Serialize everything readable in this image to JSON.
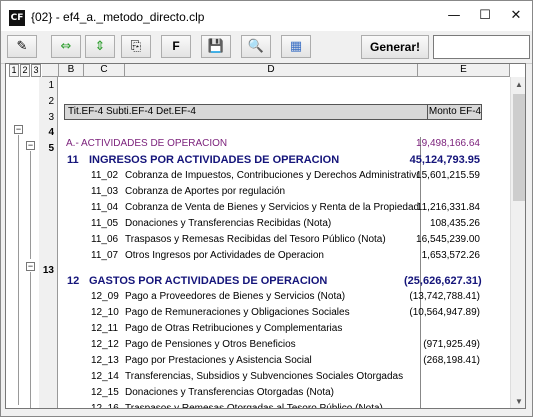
{
  "window": {
    "app_icon": "CF",
    "title": "{02} - ef4_a._metodo_directo.clp",
    "min_glyph": "—",
    "max_glyph": "☐",
    "close_glyph": "✕"
  },
  "toolbar": {
    "buttons": [
      {
        "name": "pencil-icon",
        "glyph": "✎"
      },
      {
        "name": "horizontal-arrows-icon",
        "glyph": "⇔"
      },
      {
        "name": "vertical-arrows-icon",
        "glyph": "⇕"
      },
      {
        "name": "copy-icon",
        "glyph": "⎘"
      },
      {
        "name": "f-button",
        "glyph": "F"
      },
      {
        "name": "save-icon",
        "glyph": "💾"
      },
      {
        "name": "preview-icon",
        "glyph": "🔍"
      },
      {
        "name": "grid-icon",
        "glyph": "▦"
      }
    ],
    "generate_label": "Generar!",
    "input_value": ""
  },
  "sheet": {
    "outline_levels": [
      "1",
      "2",
      "3"
    ],
    "columns": [
      "B",
      "C",
      "D",
      "E"
    ],
    "header": {
      "left": "Tit.EF-4  Subti.EF-4  Det.EF-4",
      "right": "Monto EF-4"
    },
    "row_numbers": [
      "1",
      "2",
      "3",
      "4",
      "5",
      "13"
    ],
    "section_a": {
      "label": "A.- ACTIVIDADES DE OPERACION",
      "amount": "19,498,166.64"
    },
    "group_11": {
      "code": "11",
      "label": "INGRESOS POR ACTIVIDADES DE OPERACION",
      "amount": "45,124,793.95",
      "items": [
        {
          "code": "11_02",
          "desc": "Cobranza de Impuestos, Contribuciones y Derechos Administrativos",
          "amount": "15,601,215.59"
        },
        {
          "code": "11_03",
          "desc": "Cobranza de Aportes por regulación",
          "amount": ""
        },
        {
          "code": "11_04",
          "desc": "Cobranza de Venta de Bienes y Servicios y Renta de la Propiedad",
          "amount": "11,216,331.84"
        },
        {
          "code": "11_05",
          "desc": "Donaciones y Transferencias Recibidas (Nota)",
          "amount": "108,435.26"
        },
        {
          "code": "11_06",
          "desc": "Traspasos y Remesas Recibidas del Tesoro Público (Nota)",
          "amount": "16,545,239.00"
        },
        {
          "code": "11_07",
          "desc": "Otros Ingresos por Actividades de Operacion",
          "amount": "1,653,572.26"
        }
      ]
    },
    "group_12": {
      "code": "12",
      "label": "GASTOS POR ACTIVIDADES DE OPERACION",
      "amount": "(25,626,627.31)",
      "items": [
        {
          "code": "12_09",
          "desc": "Pago a Proveedores de Bienes y Servicios (Nota)",
          "amount": "(13,742,788.41)"
        },
        {
          "code": "12_10",
          "desc": "Pago de Remuneraciones y Obligaciones Sociales",
          "amount": "(10,564,947.89)"
        },
        {
          "code": "12_11",
          "desc": "Pago de Otras Retribuciones y Complementarias",
          "amount": ""
        },
        {
          "code": "12_12",
          "desc": "Pago de Pensiones y Otros Beneficios",
          "amount": "(971,925.49)"
        },
        {
          "code": "12_13",
          "desc": "Pago por Prestaciones y Asistencia Social",
          "amount": "(268,198.41)"
        },
        {
          "code": "12_14",
          "desc": "Transferencias, Subsidios y Subvenciones Sociales Otorgadas",
          "amount": ""
        },
        {
          "code": "12_15",
          "desc": "Donaciones y Transferencias Otorgadas (Nota)",
          "amount": ""
        },
        {
          "code": "12_16",
          "desc": "Traspasos y Remesas Otorgadas al Tesoro Público (Nota)",
          "amount": ""
        }
      ]
    }
  }
}
